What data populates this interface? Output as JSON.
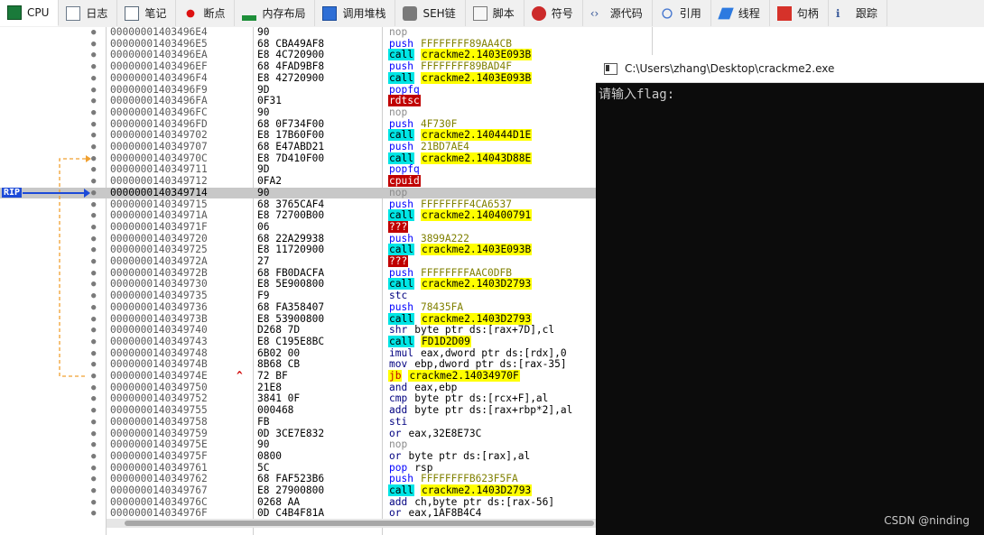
{
  "tabs": [
    {
      "label": "CPU",
      "icon": "cpu-icon",
      "active": true
    },
    {
      "label": "日志",
      "icon": "log-icon"
    },
    {
      "label": "笔记",
      "icon": "notes-icon"
    },
    {
      "label": "断点",
      "icon": "breakpoint-icon"
    },
    {
      "label": "内存布局",
      "icon": "memory-map-icon"
    },
    {
      "label": "调用堆栈",
      "icon": "call-stack-icon"
    },
    {
      "label": "SEH链",
      "icon": "seh-chain-icon"
    },
    {
      "label": "脚本",
      "icon": "script-icon"
    },
    {
      "label": "符号",
      "icon": "symbols-icon"
    },
    {
      "label": "源代码",
      "icon": "source-icon"
    },
    {
      "label": "引用",
      "icon": "references-icon"
    },
    {
      "label": "线程",
      "icon": "threads-icon"
    },
    {
      "label": "句柄",
      "icon": "handles-icon"
    },
    {
      "label": "跟踪",
      "icon": "trace-icon"
    }
  ],
  "rip_label": "RIP",
  "rows": [
    {
      "addr": "00000001403496E4",
      "bytes": "90",
      "mn": "nop",
      "mc": "nop",
      "op": "",
      "oc": ""
    },
    {
      "addr": "00000001403496E5",
      "bytes": "68 CBA49AF8",
      "mn": "push",
      "mc": "push",
      "op": "FFFFFFFF89AA4CB",
      "oc": "imm"
    },
    {
      "addr": "00000001403496EA",
      "bytes": "E8 4C720900",
      "mn": "call",
      "mc": "call",
      "op": "crackme2.1403E093B",
      "oc": "tgt"
    },
    {
      "addr": "00000001403496EF",
      "bytes": "68 4FAD9BF8",
      "mn": "push",
      "mc": "push",
      "op": "FFFFFFFF89BAD4F",
      "oc": "imm"
    },
    {
      "addr": "00000001403496F4",
      "bytes": "E8 42720900",
      "mn": "call",
      "mc": "call",
      "op": "crackme2.1403E093B",
      "oc": "tgt"
    },
    {
      "addr": "00000001403496F9",
      "bytes": "9D",
      "mn": "popfq",
      "mc": "push",
      "op": "",
      "oc": ""
    },
    {
      "addr": "00000001403496FA",
      "bytes": "0F31",
      "mn": "rdtsc",
      "mc": "rd",
      "op": "",
      "oc": ""
    },
    {
      "addr": "00000001403496FC",
      "bytes": "90",
      "mn": "nop",
      "mc": "nop",
      "op": "",
      "oc": ""
    },
    {
      "addr": "00000001403496FD",
      "bytes": "68 0F734F00",
      "mn": "push",
      "mc": "push",
      "op": "4F730F",
      "oc": "imm"
    },
    {
      "addr": "0000000140349702",
      "bytes": "E8 17B60F00",
      "mn": "call",
      "mc": "call",
      "op": "crackme2.140444D1E",
      "oc": "tgt"
    },
    {
      "addr": "0000000140349707",
      "bytes": "68 E47ABD21",
      "mn": "push",
      "mc": "push",
      "op": "21BD7AE4",
      "oc": "imm"
    },
    {
      "addr": "000000014034970C",
      "bytes": "E8 7D410F00",
      "mn": "call",
      "mc": "call",
      "op": "crackme2.14043D88E",
      "oc": "tgt"
    },
    {
      "addr": "0000000140349711",
      "bytes": "9D",
      "mn": "popfq",
      "mc": "push",
      "op": "",
      "oc": ""
    },
    {
      "addr": "0000000140349712",
      "bytes": "0FA2",
      "mn": "cpuid",
      "mc": "rd",
      "op": "",
      "oc": ""
    },
    {
      "addr": "0000000140349714",
      "bytes": "90",
      "mn": "nop",
      "mc": "nop",
      "op": "",
      "oc": "",
      "rip": true
    },
    {
      "addr": "0000000140349715",
      "bytes": "68 3765CAF4",
      "mn": "push",
      "mc": "push",
      "op": "FFFFFFFF4CA6537",
      "oc": "imm"
    },
    {
      "addr": "000000014034971A",
      "bytes": "E8 72700B00",
      "mn": "call",
      "mc": "call",
      "op": "crackme2.140400791",
      "oc": "tgt"
    },
    {
      "addr": "000000014034971F",
      "bytes": "06",
      "mn": "???",
      "mc": "rd",
      "op": "",
      "oc": ""
    },
    {
      "addr": "0000000140349720",
      "bytes": "68 22A29938",
      "mn": "push",
      "mc": "push",
      "op": "3899A222",
      "oc": "imm"
    },
    {
      "addr": "0000000140349725",
      "bytes": "E8 11720900",
      "mn": "call",
      "mc": "call",
      "op": "crackme2.1403E093B",
      "oc": "tgt"
    },
    {
      "addr": "000000014034972A",
      "bytes": "27",
      "mn": "???",
      "mc": "rd",
      "op": "",
      "oc": ""
    },
    {
      "addr": "000000014034972B",
      "bytes": "68 FB0DACFA",
      "mn": "push",
      "mc": "push",
      "op": "FFFFFFFFAAC0DFB",
      "oc": "imm"
    },
    {
      "addr": "0000000140349730",
      "bytes": "E8 5E900800",
      "mn": "call",
      "mc": "call",
      "op": "crackme2.1403D2793",
      "oc": "tgt"
    },
    {
      "addr": "0000000140349735",
      "bytes": "F9",
      "mn": "stc",
      "mc": "pl",
      "op": "",
      "oc": ""
    },
    {
      "addr": "0000000140349736",
      "bytes": "68 FA358407",
      "mn": "push",
      "mc": "push",
      "op": "78435FA",
      "oc": "imm"
    },
    {
      "addr": "000000014034973B",
      "bytes": "E8 53900800",
      "mn": "call",
      "mc": "call",
      "op": "crackme2.1403D2793",
      "oc": "tgt"
    },
    {
      "addr": "0000000140349740",
      "bytes": "D268 7D",
      "mn": "shr",
      "mc": "pl",
      "op": "byte ptr ds:[rax+7D],cl",
      "oc": "pl"
    },
    {
      "addr": "0000000140349743",
      "bytes": "E8 C195E8BC",
      "mn": "call",
      "mc": "call",
      "op": "FD1D2D09",
      "oc": "tgt"
    },
    {
      "addr": "0000000140349748",
      "bytes": "6B02 00",
      "mn": "imul",
      "mc": "pl",
      "op": "eax,dword ptr ds:[rdx],0",
      "oc": "pl"
    },
    {
      "addr": "000000014034974B",
      "bytes": "8B68 CB",
      "mn": "mov",
      "mc": "pl",
      "op": "ebp,dword ptr ds:[rax-35]",
      "oc": "pl"
    },
    {
      "addr": "000000014034974E",
      "bytes": "72 BF",
      "mn": "jb",
      "mc": "jb",
      "op": "crackme2.14034970F",
      "oc": "tgt",
      "uparrow": "^"
    },
    {
      "addr": "0000000140349750",
      "bytes": "21E8",
      "mn": "and",
      "mc": "pl",
      "op": "eax,ebp",
      "oc": "pl"
    },
    {
      "addr": "0000000140349752",
      "bytes": "3841 0F",
      "mn": "cmp",
      "mc": "pl",
      "op": "byte ptr ds:[rcx+F],al",
      "oc": "pl"
    },
    {
      "addr": "0000000140349755",
      "bytes": "000468",
      "mn": "add",
      "mc": "pl",
      "op": "byte ptr ds:[rax+rbp*2],al",
      "oc": "pl"
    },
    {
      "addr": "0000000140349758",
      "bytes": "FB",
      "mn": "sti",
      "mc": "pl",
      "op": "",
      "oc": ""
    },
    {
      "addr": "0000000140349759",
      "bytes": "0D 3CE7E832",
      "mn": "or",
      "mc": "pl",
      "op": "eax,32E8E73C",
      "oc": "pl"
    },
    {
      "addr": "000000014034975E",
      "bytes": "90",
      "mn": "nop",
      "mc": "nop",
      "op": "",
      "oc": ""
    },
    {
      "addr": "000000014034975F",
      "bytes": "0800",
      "mn": "or",
      "mc": "pl",
      "op": "byte ptr ds:[rax],al",
      "oc": "pl"
    },
    {
      "addr": "0000000140349761",
      "bytes": "5C",
      "mn": "pop",
      "mc": "push",
      "op": "rsp",
      "oc": "pl"
    },
    {
      "addr": "0000000140349762",
      "bytes": "68 FAF523B6",
      "mn": "push",
      "mc": "push",
      "op": "FFFFFFFFB623F5FA",
      "oc": "imm"
    },
    {
      "addr": "0000000140349767",
      "bytes": "E8 27900800",
      "mn": "call",
      "mc": "call",
      "op": "crackme2.1403D2793",
      "oc": "tgt"
    },
    {
      "addr": "000000014034976C",
      "bytes": "0268 AA",
      "mn": "add",
      "mc": "pl",
      "op": "ch,byte ptr ds:[rax-56]",
      "oc": "pl"
    },
    {
      "addr": "000000014034976F",
      "bytes": "0D C4B4F81A",
      "mn": "or",
      "mc": "pl",
      "op": "eax,1AF8B4C4",
      "oc": "pl"
    }
  ],
  "console": {
    "title": "C:\\Users\\zhang\\Desktop\\crackme2.exe",
    "text": "请输入flag:"
  },
  "watermark": "CSDN @ninding",
  "colors": {
    "call_bg": "#00e5e5",
    "target_bg": "#ffff00",
    "bad_bg": "#c00000",
    "rip_row": "#c8c8c8",
    "rip_arrow": "#1c4ad8",
    "jump_arrow": "#f0a030"
  }
}
